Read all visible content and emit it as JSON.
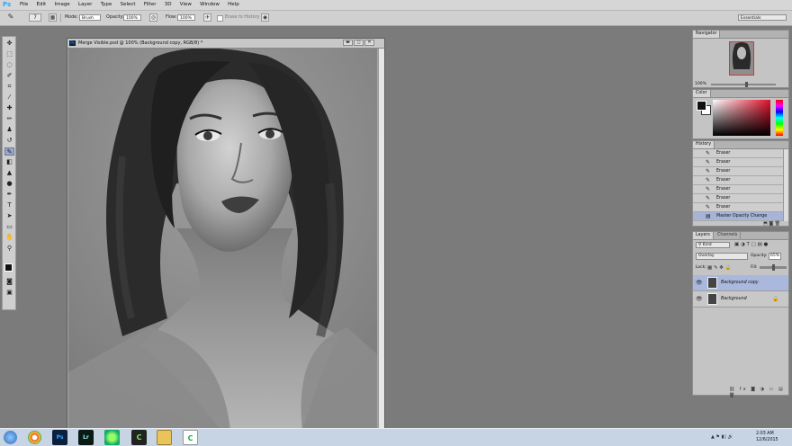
{
  "menu": {
    "logo": "Ps",
    "items": [
      "File",
      "Edit",
      "Image",
      "Layer",
      "Type",
      "Select",
      "Filter",
      "3D",
      "View",
      "Window",
      "Help"
    ]
  },
  "options": {
    "brush_size": "7",
    "mode_label": "Mode:",
    "mode_value": "Brush",
    "opacity_label": "Opacity:",
    "opacity_value": "100%",
    "flow_label": "Flow:",
    "flow_value": "100%",
    "erase_history_label": "Erase to History",
    "workspace": "Essentials"
  },
  "document": {
    "title": "Merge Visible.psd @ 100% (Background copy, RGB/8) *",
    "minimize": "▬",
    "restore": "◻",
    "close": "✕"
  },
  "navigator": {
    "tab": "Navigator",
    "zoom": "100%"
  },
  "color": {
    "tab": "Color"
  },
  "history": {
    "tab": "History",
    "items": [
      {
        "label": "Eraser",
        "active": false
      },
      {
        "label": "Eraser",
        "active": false
      },
      {
        "label": "Eraser",
        "active": false
      },
      {
        "label": "Eraser",
        "active": false
      },
      {
        "label": "Eraser",
        "active": false
      },
      {
        "label": "Eraser",
        "active": false
      },
      {
        "label": "Eraser",
        "active": false
      },
      {
        "label": "Master Opacity Change",
        "active": true
      }
    ]
  },
  "layers": {
    "tab": "Layers",
    "tab2": "Channels",
    "filter": "Kind",
    "blend_mode": "Overlay",
    "opacity_label": "Opacity:",
    "opacity_value": "65%",
    "lock_label": "Lock:",
    "fill_label": "Fill:",
    "rows": [
      {
        "name": "Background copy",
        "active": true
      },
      {
        "name": "Background",
        "active": false
      }
    ]
  },
  "taskbar": {
    "time": "2:03 AM",
    "date": "12/6/2015",
    "apps": [
      "Ps",
      "Lr",
      "C",
      "C"
    ]
  },
  "colors": {
    "accent": "#2aa7ff",
    "selection": "#a9b8dc"
  }
}
